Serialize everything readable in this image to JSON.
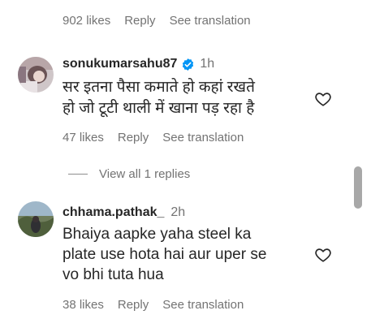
{
  "top_meta": {
    "likes": "902 likes",
    "reply": "Reply",
    "translate": "See translation"
  },
  "comments": [
    {
      "username": "sonukumarsahu87",
      "verified": true,
      "time": "1h",
      "text_line1": "सर इतना पैसा कमाते हो कहां रखते",
      "text_line2": "हो जो टूटी थाली में खाना पड़ रहा है",
      "likes": "47 likes",
      "reply": "Reply",
      "translate": "See translation",
      "view_replies": "View all 1 replies"
    },
    {
      "username": "chhama.pathak_",
      "verified": false,
      "time": "2h",
      "text_line1": "Bhaiya aapke yaha steel ka",
      "text_line2": "plate use hota hai aur uper se",
      "text_line3": "vo bhi tuta hua",
      "likes": "38 likes",
      "reply": "Reply",
      "translate": "See translation"
    }
  ],
  "colors": {
    "text": "#262626",
    "muted": "#737373",
    "verified": "#0095f6",
    "scrollbar": "#a8a8a8"
  },
  "icons": {
    "verified": "verified-badge-icon",
    "like": "heart-outline-icon"
  }
}
